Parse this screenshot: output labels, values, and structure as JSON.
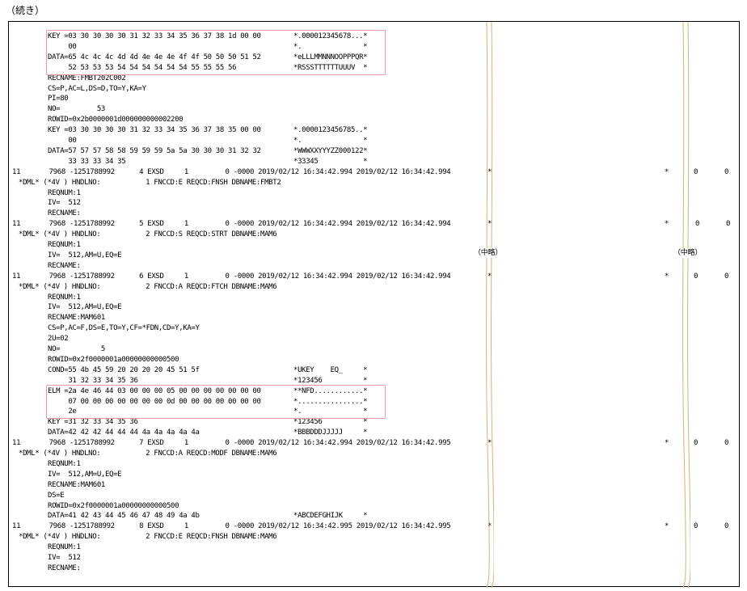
{
  "caption": "（続き）",
  "omitted_label": "（中略）",
  "lines": [
    {
      "segments": [
        {
          "col": 58,
          "text": "KEY =03 30 30 30 30 31 32 33 34 35 36 37 38 1d 00 00"
        },
        {
          "col": 362,
          "text": "*.000012345678...*"
        }
      ]
    },
    {
      "segments": [
        {
          "col": 58,
          "text": "     00"
        },
        {
          "col": 362,
          "text": "*.               *"
        }
      ]
    },
    {
      "segments": [
        {
          "col": 58,
          "text": "DATA=65 4c 4c 4c 4d 4d 4e 4e 4e 4f 4f 50 50 50 51 52"
        },
        {
          "col": 362,
          "text": "*eLLLMMNNNOOPPPQR*"
        }
      ]
    },
    {
      "segments": [
        {
          "col": 58,
          "text": "     52 53 53 53 54 54 54 54 54 54 55 55 55 56"
        },
        {
          "col": 362,
          "text": "*RSSSTTTTTTUUUV  *"
        }
      ]
    },
    {
      "segments": [
        {
          "col": 58,
          "text": "RECNAME:FMBT202C002"
        }
      ]
    },
    {
      "segments": [
        {
          "col": 58,
          "text": "CS=P,AC=L,DS=D,TO=Y,KA=Y"
        }
      ]
    },
    {
      "segments": [
        {
          "col": 58,
          "text": "PI=80"
        }
      ]
    },
    {
      "segments": [
        {
          "col": 58,
          "text": "NO=         53"
        }
      ]
    },
    {
      "segments": [
        {
          "col": 58,
          "text": "ROWID=0x2b0000001d000000000002200"
        }
      ]
    },
    {
      "segments": [
        {
          "col": 58,
          "text": "KEY =03 30 30 30 30 31 32 33 34 35 36 37 38 35 00 00"
        },
        {
          "col": 362,
          "text": "*.0000123456785..*"
        }
      ]
    },
    {
      "segments": [
        {
          "col": 58,
          "text": "     00"
        },
        {
          "col": 362,
          "text": "*.               *"
        }
      ]
    },
    {
      "segments": [
        {
          "col": 58,
          "text": "DATA=57 57 57 58 58 59 59 59 5a 5a 30 30 30 31 32 32"
        },
        {
          "col": 362,
          "text": "*WWWXXYYYZZ000122*"
        }
      ]
    },
    {
      "segments": [
        {
          "col": 58,
          "text": "     33 33 33 34 35"
        },
        {
          "col": 362,
          "text": "*33345           *"
        }
      ]
    },
    {
      "segments": [
        {
          "col": 14,
          "text": "11       7968 -1251788992      4 EXSD     1         0 -0000 2019/02/12 16:34:42.994 2019/02/12 16:34:42.994"
        },
        {
          "col": 602,
          "text": "*"
        },
        {
          "col": 821,
          "text": "*"
        },
        {
          "col": 857,
          "text": "0"
        },
        {
          "col": 895,
          "text": "0"
        }
      ]
    },
    {
      "segments": [
        {
          "col": 22,
          "text": "*DML* (*4V ) HNDLNO:           1 FNCCD:E REQCD:FNSH DBNAME:FMBT2"
        }
      ]
    },
    {
      "segments": [
        {
          "col": 58,
          "text": "REQNUM:1"
        }
      ]
    },
    {
      "segments": [
        {
          "col": 58,
          "text": "IV=  512"
        }
      ]
    },
    {
      "segments": [
        {
          "col": 58,
          "text": "RECNAME:"
        }
      ]
    },
    {
      "segments": [
        {
          "col": 14,
          "text": "11       7968 -1251788992      5 EXSD     1         0 -0000 2019/02/12 16:34:42.994 2019/02/12 16:34:42.994"
        },
        {
          "col": 602,
          "text": "*"
        },
        {
          "col": 821,
          "text": "*"
        },
        {
          "col": 859,
          "text": "0"
        },
        {
          "col": 897,
          "text": "0"
        }
      ]
    },
    {
      "segments": [
        {
          "col": 22,
          "text": "*DML* (*4V ) HNDLNO:           2 FNCCD:S REQCD:STRT DBNAME:MAM6"
        }
      ]
    },
    {
      "segments": [
        {
          "col": 58,
          "text": "REQNUM:1"
        }
      ]
    },
    {
      "segments": [
        {
          "col": 58,
          "text": "IV=  512,AM=U,EQ=E"
        }
      ]
    },
    {
      "segments": [
        {
          "col": 58,
          "text": "RECNAME:"
        }
      ]
    },
    {
      "segments": [
        {
          "col": 14,
          "text": "11       7968 -1251788992      6 EXSD     1         0 -0000 2019/02/12 16:34:42.994 2019/02/12 16:34:42.994"
        },
        {
          "col": 602,
          "text": "*"
        },
        {
          "col": 821,
          "text": "*"
        },
        {
          "col": 857,
          "text": "0"
        },
        {
          "col": 895,
          "text": "0"
        }
      ]
    },
    {
      "segments": [
        {
          "col": 22,
          "text": "*DML* (*4V ) HNDLNO:           2 FNCCD:A REQCD:FTCH DBNAME:MAM6"
        }
      ]
    },
    {
      "segments": [
        {
          "col": 58,
          "text": "REQNUM:1"
        }
      ]
    },
    {
      "segments": [
        {
          "col": 58,
          "text": "IV=  512,AM=U,EQ=E"
        }
      ]
    },
    {
      "segments": [
        {
          "col": 58,
          "text": "RECNAME:MAM601"
        }
      ]
    },
    {
      "segments": [
        {
          "col": 58,
          "text": "CS=P,AC=F,DS=E,TO=Y,CF=*FDN,CD=Y,KA=Y"
        }
      ]
    },
    {
      "segments": [
        {
          "col": 58,
          "text": "2U=02"
        }
      ]
    },
    {
      "segments": [
        {
          "col": 58,
          "text": "NO=          5"
        }
      ]
    },
    {
      "segments": [
        {
          "col": 58,
          "text": "ROWID=0x2f0000001a00000000000500"
        }
      ]
    },
    {
      "segments": [
        {
          "col": 58,
          "text": "COND=55 4b 45 59 20 20 20 20 45 51 5f"
        },
        {
          "col": 362,
          "text": "*UKEY    EQ_     *"
        }
      ]
    },
    {
      "segments": [
        {
          "col": 58,
          "text": "     31 32 33 34 35 36"
        },
        {
          "col": 362,
          "text": "*123456          *"
        }
      ]
    },
    {
      "segments": [
        {
          "col": 58,
          "text": "ELM =2a 4e 46 44 03 00 00 00 05 00 00 00 00 00 00 00"
        },
        {
          "col": 362,
          "text": "**NFD............*"
        }
      ]
    },
    {
      "segments": [
        {
          "col": 58,
          "text": "     07 00 00 00 00 00 00 00 0d 00 00 00 00 00 00 00"
        },
        {
          "col": 362,
          "text": "*................*"
        }
      ]
    },
    {
      "segments": [
        {
          "col": 58,
          "text": "     2e"
        },
        {
          "col": 362,
          "text": "*.               *"
        }
      ]
    },
    {
      "segments": [
        {
          "col": 58,
          "text": "KEY =31 32 33 34 35 36"
        },
        {
          "col": 362,
          "text": "*123456          *"
        }
      ]
    },
    {
      "segments": [
        {
          "col": 58,
          "text": "DATA=42 42 42 44 44 44 4a 4a 4a 4a 4a"
        },
        {
          "col": 362,
          "text": "*BBBDDDJJJJJ     *"
        }
      ]
    },
    {
      "segments": [
        {
          "col": 14,
          "text": "11       7968 -1251788992      7 EXSD     1         0 -0000 2019/02/12 16:34:42.994 2019/02/12 16:34:42.995"
        },
        {
          "col": 602,
          "text": "*"
        },
        {
          "col": 821,
          "text": "*"
        },
        {
          "col": 857,
          "text": "0"
        },
        {
          "col": 895,
          "text": "0"
        }
      ]
    },
    {
      "segments": [
        {
          "col": 22,
          "text": "*DML* (*4V ) HNDLNO:           2 FNCCD:A REQCD:MODF DBNAME:MAM6"
        }
      ]
    },
    {
      "segments": [
        {
          "col": 58,
          "text": "REQNUM:1"
        }
      ]
    },
    {
      "segments": [
        {
          "col": 58,
          "text": "IV=  512,AM=U,EQ=E"
        }
      ]
    },
    {
      "segments": [
        {
          "col": 58,
          "text": "RECNAME:MAM601"
        }
      ]
    },
    {
      "segments": [
        {
          "col": 58,
          "text": "DS=E"
        }
      ]
    },
    {
      "segments": [
        {
          "col": 58,
          "text": "ROWID=0x2f0000001a00000000000500"
        }
      ]
    },
    {
      "segments": [
        {
          "col": 58,
          "text": "DATA=41 42 43 44 45 46 47 48 49 4a 4b"
        },
        {
          "col": 362,
          "text": "*ABCDEFGHIJK     *"
        }
      ]
    },
    {
      "segments": [
        {
          "col": 14,
          "text": "11       7968 -1251788992      8 EXSD     1         0 -0000 2019/02/12 16:34:42.995 2019/02/12 16:34:42.995"
        },
        {
          "col": 602,
          "text": "*"
        },
        {
          "col": 821,
          "text": "*"
        },
        {
          "col": 857,
          "text": "0"
        },
        {
          "col": 895,
          "text": "0"
        }
      ]
    },
    {
      "segments": [
        {
          "col": 22,
          "text": "*DML* (*4V ) HNDLNO:           2 FNCCD:E REQCD:FNSH DBNAME:MAM6"
        }
      ]
    },
    {
      "segments": [
        {
          "col": 58,
          "text": "REQNUM:1"
        }
      ]
    },
    {
      "segments": [
        {
          "col": 58,
          "text": "IV=  512"
        }
      ]
    },
    {
      "segments": [
        {
          "col": 58,
          "text": "RECNAME:"
        }
      ]
    }
  ],
  "highlights": [
    {
      "from_line": 0,
      "to_line": 3
    },
    {
      "from_line": 34,
      "to_line": 36
    }
  ],
  "colors": {
    "highlight_border": "#ec9aa6",
    "break_lines": "#d8b07a",
    "text": "#000000"
  }
}
